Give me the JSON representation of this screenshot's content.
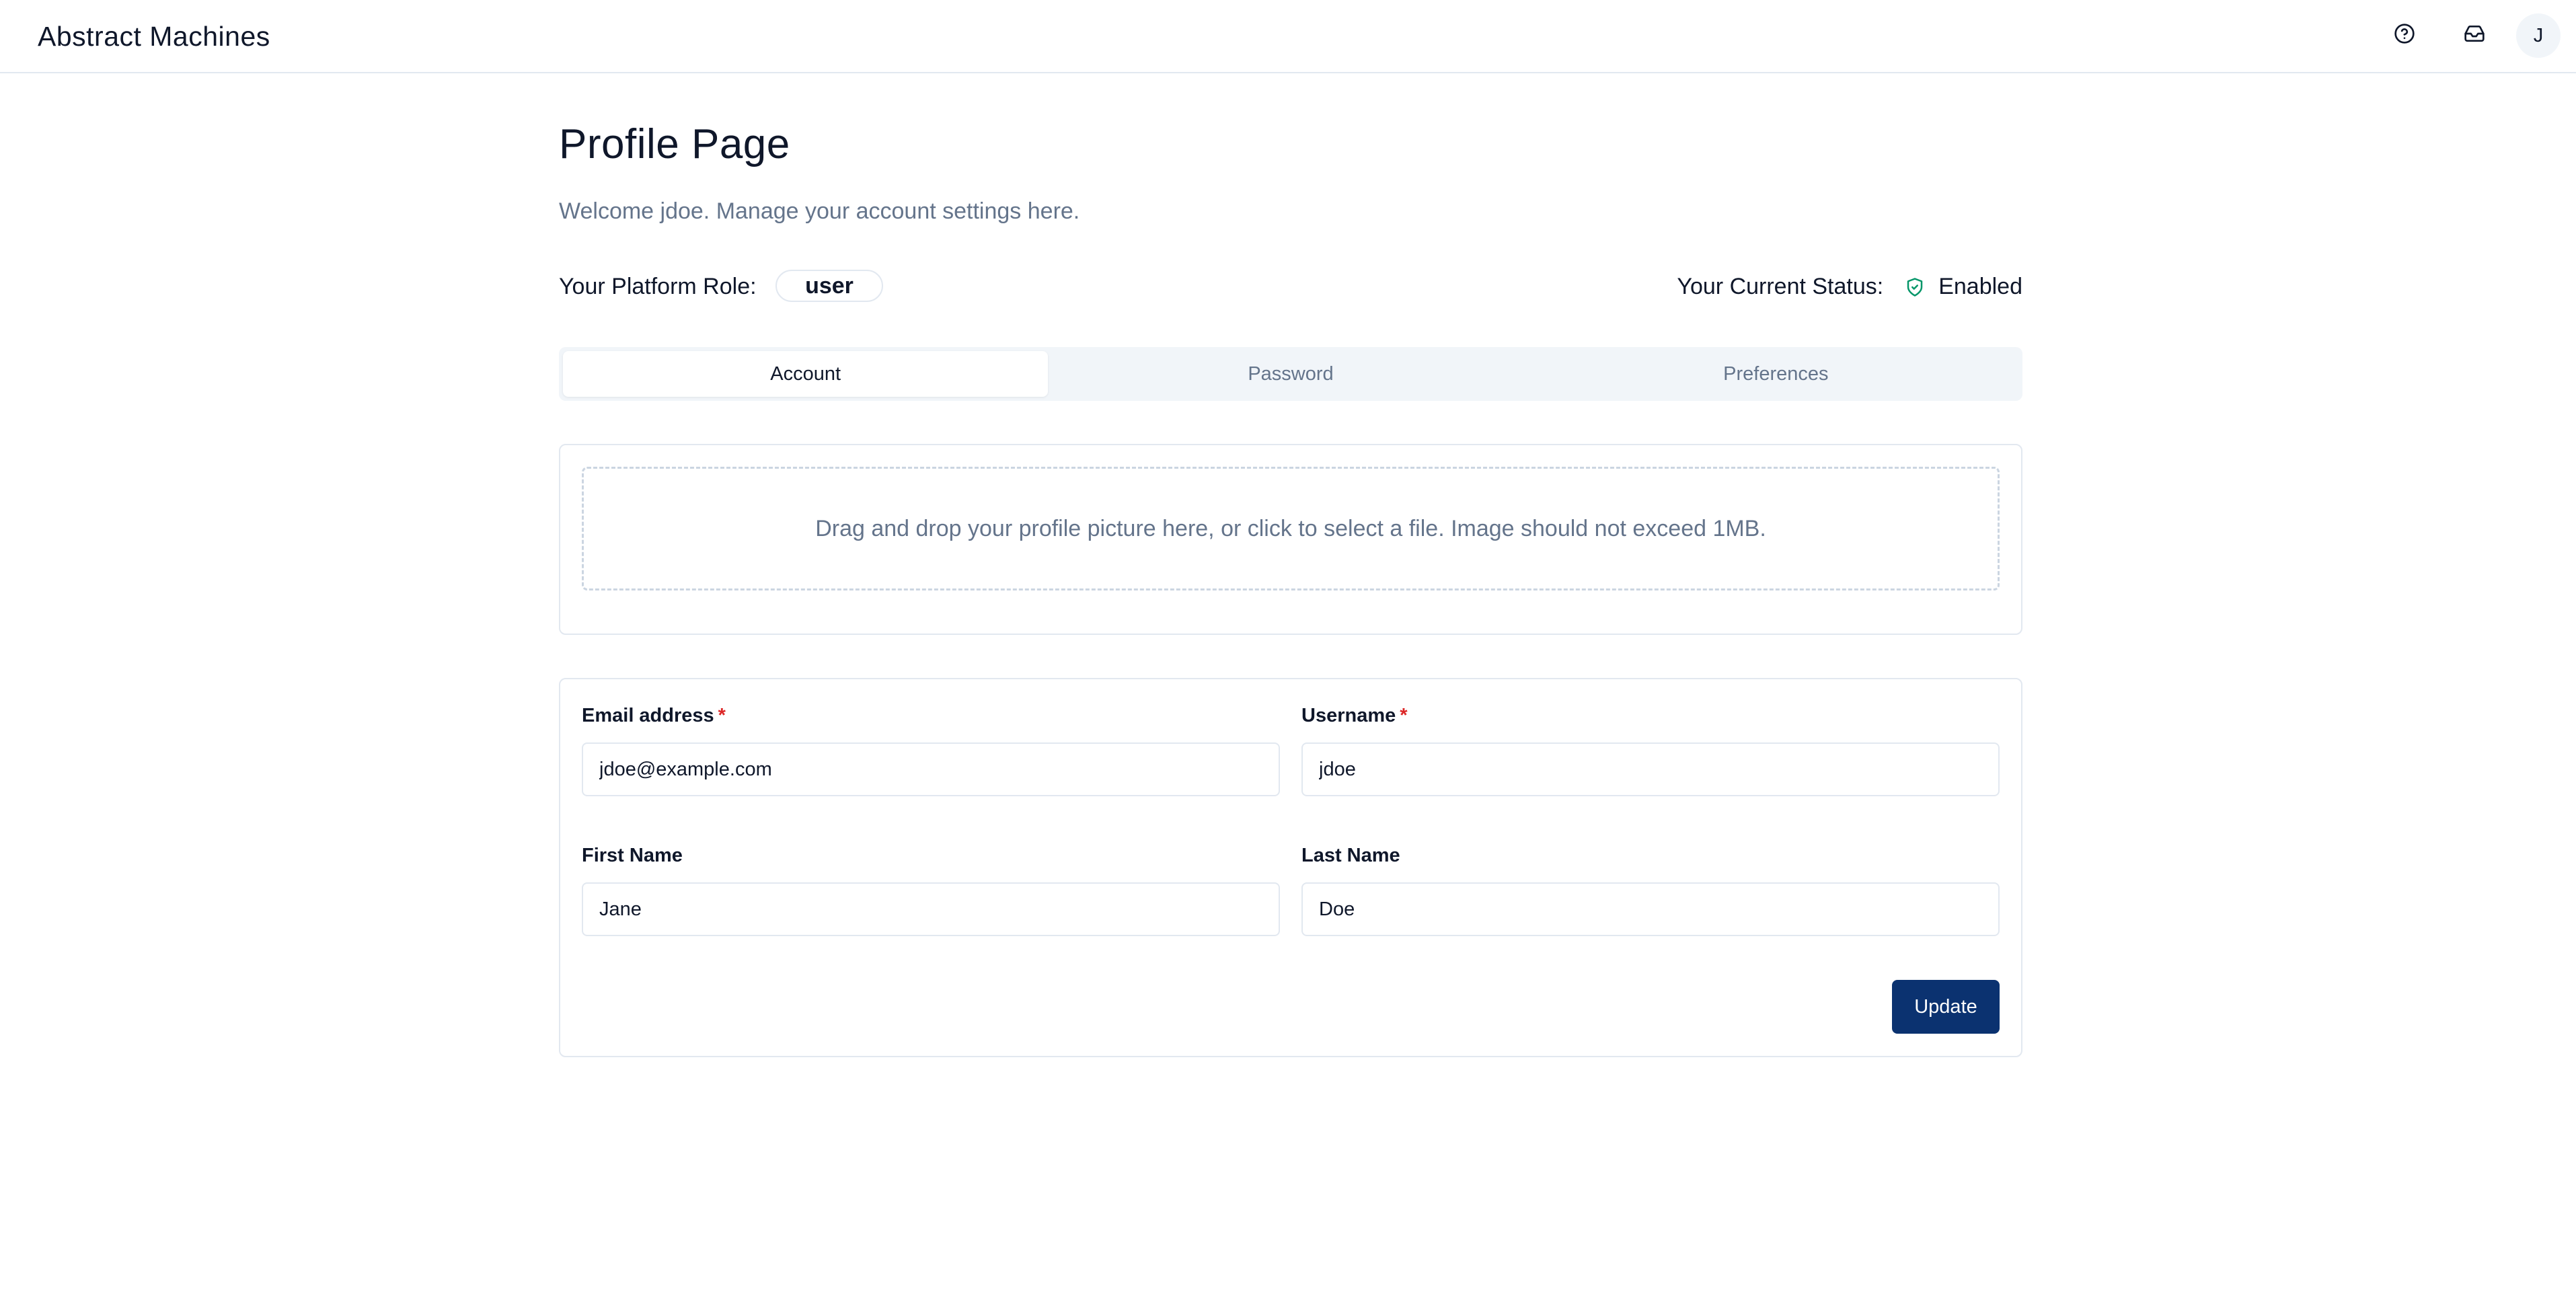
{
  "app": {
    "logo_text": "Abstract Machines"
  },
  "header": {
    "avatar_initial": "J",
    "icons": [
      "help-circle-icon",
      "inbox-icon"
    ]
  },
  "page": {
    "title": "Profile Page",
    "subtitle": "Welcome jdoe. Manage your account settings here."
  },
  "role": {
    "label": "Your Platform Role:",
    "value": "user"
  },
  "status": {
    "label": "Your Current Status:",
    "value": "Enabled",
    "icon": "shield-check-icon",
    "icon_color": "#059669"
  },
  "tabs": [
    {
      "label": "Account",
      "active": true
    },
    {
      "label": "Password",
      "active": false
    },
    {
      "label": "Preferences",
      "active": false
    }
  ],
  "upload": {
    "text": "Drag and drop your profile picture here, or click to select a file. Image should not exceed 1MB."
  },
  "form": {
    "email": {
      "label": "Email address",
      "required_mark": "*",
      "value": "jdoe@example.com"
    },
    "username": {
      "label": "Username",
      "required_mark": "*",
      "value": "jdoe"
    },
    "first_name": {
      "label": "First Name",
      "value": "Jane"
    },
    "last_name": {
      "label": "Last Name",
      "value": "Doe"
    },
    "submit_label": "Update"
  },
  "colors": {
    "primary": "#0b3270",
    "required": "#dc2626",
    "muted_text": "#64748b",
    "border": "#e2e8f0"
  }
}
